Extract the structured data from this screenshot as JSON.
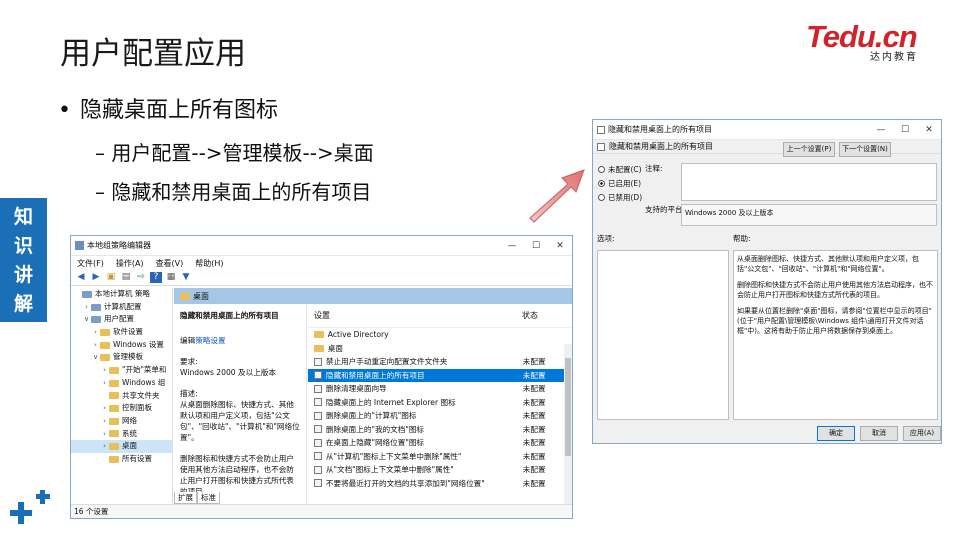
{
  "slide": {
    "title": "用户配置应用",
    "bullet": "隐藏桌面上所有图标",
    "sub1": "– 用户配置-->管理模板-->桌面",
    "sub2": "– 隐藏和禁用桌面上的所有项目",
    "side_tab": [
      "知",
      "识",
      "讲",
      "解"
    ],
    "logo_word": "Tedu.cn",
    "logo_sub": "达内教育",
    "accent": "#1a6fb7",
    "brand_red": "#d3232a"
  },
  "gpe": {
    "title": "本地组策略编辑器",
    "menu": [
      "文件(F)",
      "操作(A)",
      "查看(V)",
      "帮助(H)"
    ],
    "tree": [
      {
        "label": "本地计算机 策略",
        "arrow": "",
        "indent": 0
      },
      {
        "label": "计算机配置",
        "arrow": ">",
        "indent": 1
      },
      {
        "label": "用户配置",
        "arrow": "v",
        "indent": 1
      },
      {
        "label": "软件设置",
        "arrow": ">",
        "indent": 2
      },
      {
        "label": "Windows 设置",
        "arrow": ">",
        "indent": 2
      },
      {
        "label": "管理模板",
        "arrow": "v",
        "indent": 2
      },
      {
        "label": "\"开始\"菜单和",
        "arrow": ">",
        "indent": 3
      },
      {
        "label": "Windows 组",
        "arrow": ">",
        "indent": 3
      },
      {
        "label": "共享文件夹",
        "arrow": "",
        "indent": 3
      },
      {
        "label": "控制面板",
        "arrow": ">",
        "indent": 3
      },
      {
        "label": "网络",
        "arrow": ">",
        "indent": 3
      },
      {
        "label": "系统",
        "arrow": ">",
        "indent": 3
      },
      {
        "label": "桌面",
        "arrow": ">",
        "indent": 3
      },
      {
        "label": "所有设置",
        "arrow": "",
        "indent": 3
      }
    ],
    "pane_title": "桌面",
    "desc_title": "隐藏和禁用桌面上的所有项目",
    "edit_prefix": "编辑",
    "edit_link": "策略设置",
    "req_label": "要求:",
    "req_value": "Windows 2000 及以上版本",
    "desc_label": "描述:",
    "desc_text": "从桌面删除图标、快捷方式、其他默认项和用户定义项，包括\"公文包\"、\"回收站\"、\"计算机\"和\"网络位置\"。",
    "desc_text2": "删除图标和快捷方式不会防止用户使用其他方法启动程序，也不会防止用户打开图标和快捷方式所代表的项目。",
    "col_setting": "设置",
    "col_state": "状态",
    "rows": [
      {
        "name": "Active Directory",
        "state": "",
        "folder": true
      },
      {
        "name": "桌面",
        "state": "",
        "folder": true
      },
      {
        "name": "禁止用户手动重定向配置文件文件夹",
        "state": "未配置",
        "folder": false
      },
      {
        "name": "隐藏和禁用桌面上的所有项目",
        "state": "未配置",
        "folder": false
      },
      {
        "name": "删除清理桌面向导",
        "state": "未配置",
        "folder": false
      },
      {
        "name": "隐藏桌面上的 Internet Explorer 图标",
        "state": "未配置",
        "folder": false
      },
      {
        "name": "删除桌面上的\"计算机\"图标",
        "state": "未配置",
        "folder": false
      },
      {
        "name": "删除桌面上的\"我的文档\"图标",
        "state": "未配置",
        "folder": false
      },
      {
        "name": "在桌面上隐藏\"网络位置\"图标",
        "state": "未配置",
        "folder": false
      },
      {
        "name": "从\"计算机\"图标上下文菜单中删除\"属性\"",
        "state": "未配置",
        "folder": false
      },
      {
        "name": "从\"文档\"图标上下文菜单中删除\"属性\"",
        "state": "未配置",
        "folder": false
      },
      {
        "name": "不要将最近打开的文档的共享添加到\"网络位置\"",
        "state": "未配置",
        "folder": false
      }
    ],
    "tab_ext": "扩展",
    "tab_std": "标准",
    "status": "16 个设置"
  },
  "dialog": {
    "title": "隐藏和禁用桌面上的所有项目",
    "head": "隐藏和禁用桌面上的所有项目",
    "prev": "上一个设置(P)",
    "next": "下一个设置(N)",
    "opt_nc": "未配置(C)",
    "opt_en": "已启用(E)",
    "opt_dis": "已禁用(D)",
    "comment": "注释:",
    "platform": "支持的平台:",
    "platform_value": "Windows 2000 及以上版本",
    "options": "选项:",
    "help": "帮助:",
    "help_text": "从桌面删除图标、快捷方式、其他默认项和用户定义项，包括\"公文包\"、\"回收站\"、\"计算机\"和\"网络位置\"。",
    "help_text2": "删除图标和快捷方式不会防止用户使用其他方法启动程序，也不会防止用户打开图标和快捷方式所代表的项目。",
    "help_text3": "如果要从位置栏删除\"桌面\"图标，请参阅\"位置栏中显示的项目\"(位于\"用户配置\\管理模板\\Windows 组件\\通用打开文件对话框\"中)。这将有助于防止用户将数据保存到桌面上。",
    "ok": "确定",
    "cancel": "取消",
    "apply": "应用(A)"
  }
}
